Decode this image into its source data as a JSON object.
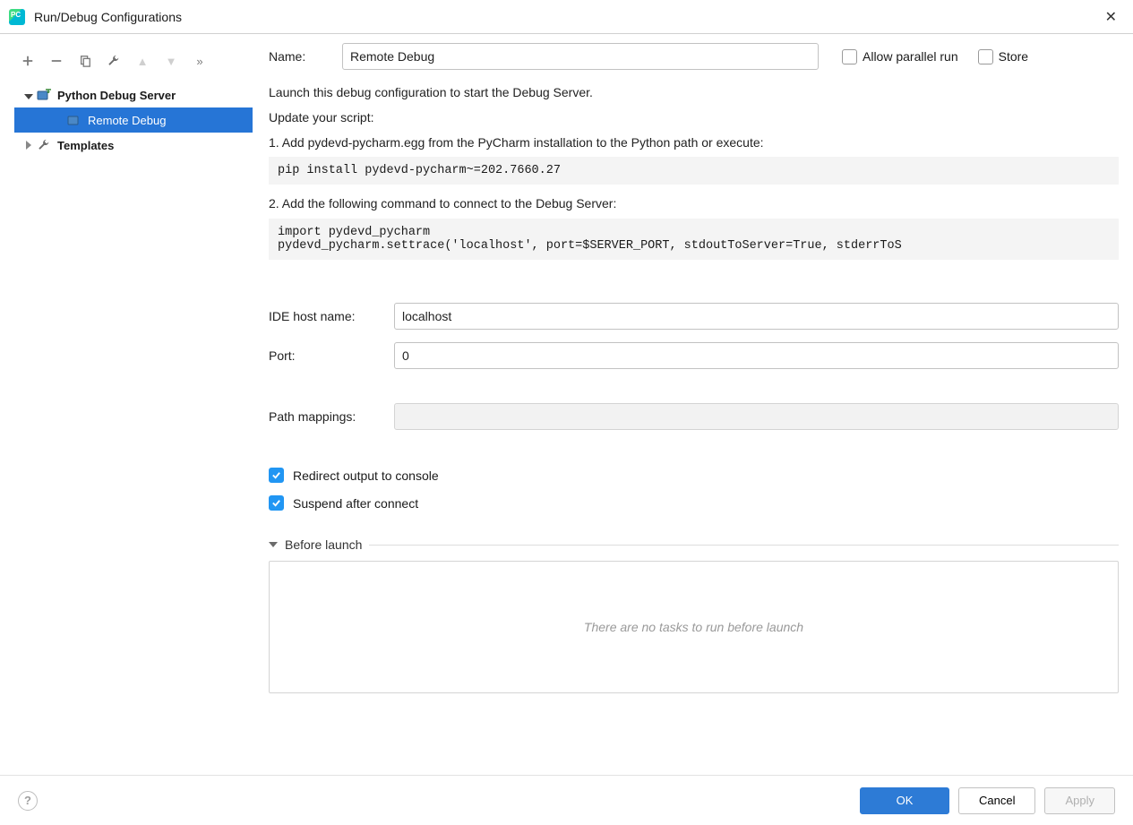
{
  "window": {
    "title": "Run/Debug Configurations"
  },
  "tree": {
    "root": "Python Debug Server",
    "child": "Remote Debug",
    "templates": "Templates"
  },
  "header": {
    "name_label": "Name:",
    "name_value": "Remote Debug",
    "allow_parallel": "Allow parallel run",
    "store": "Store"
  },
  "instructions": {
    "launch": "Launch this debug configuration to start the Debug Server.",
    "update": "Update your script:",
    "step1": "1. Add pydevd-pycharm.egg from the PyCharm installation to the Python path or execute:",
    "code1": "pip install pydevd-pycharm~=202.7660.27",
    "step2": "2. Add the following command to connect to the Debug Server:",
    "code2": "import pydevd_pycharm\npydevd_pycharm.settrace('localhost', port=$SERVER_PORT, stdoutToServer=True, stderrToS"
  },
  "fields": {
    "host_label": "IDE host name:",
    "host_value": "localhost",
    "port_label": "Port:",
    "port_value": "0",
    "mappings_label": "Path mappings:"
  },
  "checks": {
    "redirect": "Redirect output to console",
    "suspend": "Suspend after connect"
  },
  "before": {
    "title": "Before launch",
    "empty": "There are no tasks to run before launch"
  },
  "buttons": {
    "ok": "OK",
    "cancel": "Cancel",
    "apply": "Apply"
  }
}
